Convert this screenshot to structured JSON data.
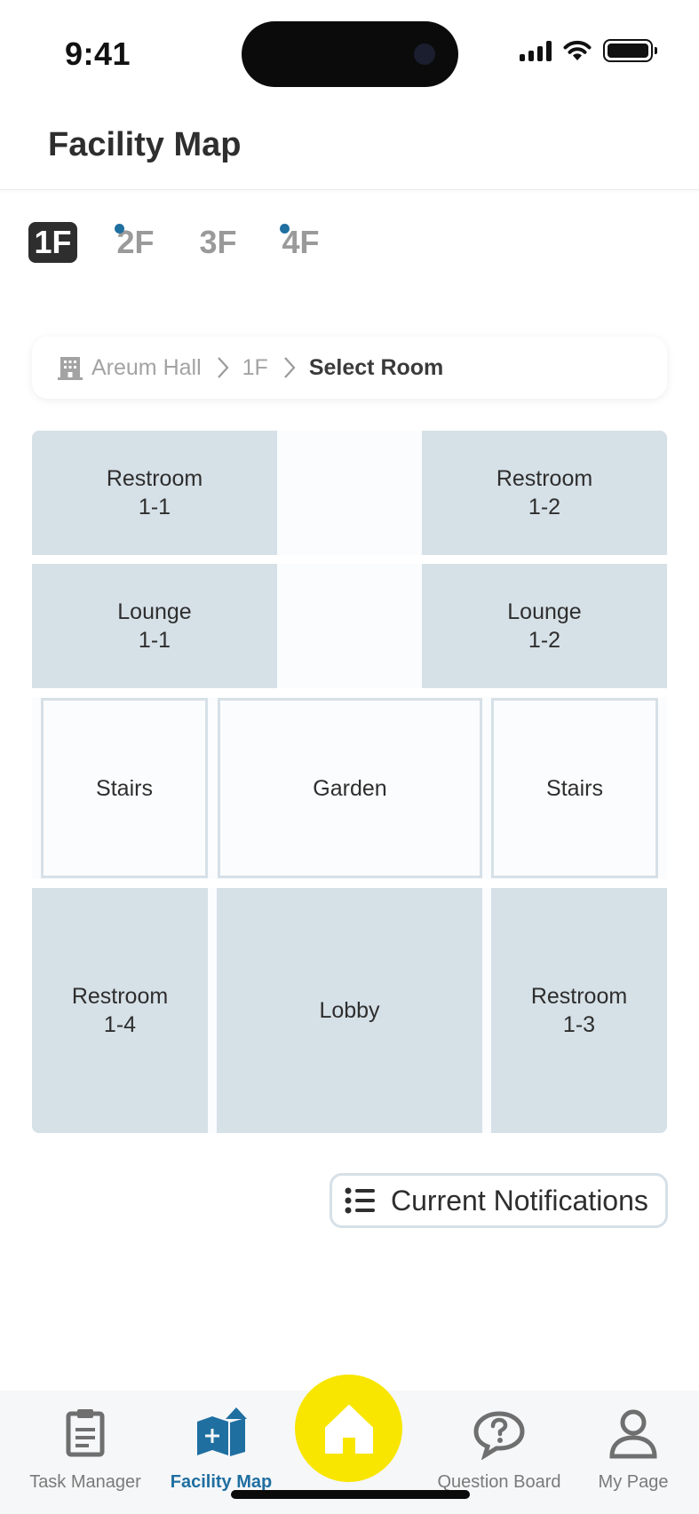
{
  "status_bar": {
    "time": "9:41"
  },
  "header": {
    "title": "Facility Map"
  },
  "floor_tabs": [
    {
      "label": "1F",
      "active": true,
      "has_notification": false
    },
    {
      "label": "2F",
      "active": false,
      "has_notification": true
    },
    {
      "label": "3F",
      "active": false,
      "has_notification": false
    },
    {
      "label": "4F",
      "active": false,
      "has_notification": true
    }
  ],
  "breadcrumb": {
    "building": "Areum Hall",
    "floor": "1F",
    "current": "Select Room"
  },
  "rooms": {
    "restroom_1_1": "Restroom\n1-1",
    "restroom_1_2": "Restroom\n1-2",
    "lounge_1_1": "Lounge\n1-1",
    "lounge_1_2": "Lounge\n1-2",
    "stairs_left": "Stairs",
    "garden": "Garden",
    "stairs_right": "Stairs",
    "restroom_1_4": "Restroom\n1-4",
    "lobby": "Lobby",
    "restroom_1_3": "Restroom\n1-3"
  },
  "notifications_button": {
    "label": "Current Notifications",
    "icon": "list-icon"
  },
  "bottom_nav": {
    "items": [
      {
        "label": "Task Manager",
        "icon": "clipboard-icon",
        "active": false
      },
      {
        "label": "Facility Map",
        "icon": "map-icon",
        "active": true
      },
      {
        "label": "Question Board",
        "icon": "question-bubble-icon",
        "active": false
      },
      {
        "label": "My Page",
        "icon": "person-icon",
        "active": false
      }
    ],
    "home_icon": "home-icon"
  },
  "colors": {
    "accent": "#1f6fa1",
    "home_button": "#f8e600",
    "room_fill": "#d6e0e7",
    "active_tab": "#2e2e2e"
  }
}
